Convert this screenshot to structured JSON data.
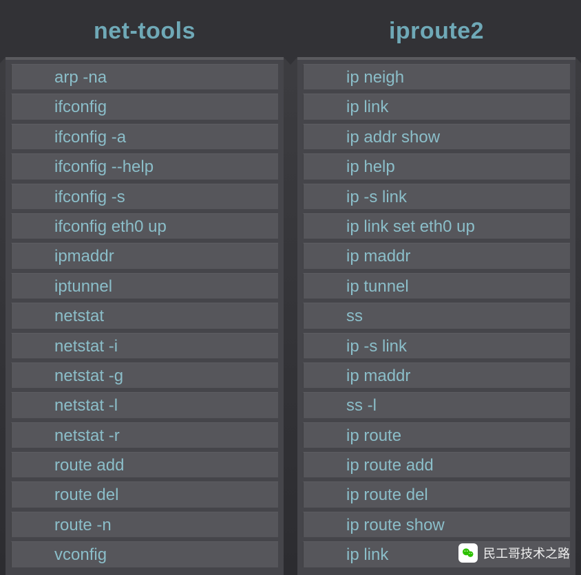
{
  "columns": [
    {
      "title": "net-tools",
      "items": [
        "arp -na",
        "ifconfig",
        "ifconfig -a",
        "ifconfig --help",
        "ifconfig -s",
        "ifconfig eth0 up",
        "ipmaddr",
        "iptunnel",
        "netstat",
        "netstat -i",
        "netstat  -g",
        "netstat -l",
        "netstat -r",
        "route add",
        "route del",
        "route -n",
        "vconfig"
      ]
    },
    {
      "title": "iproute2",
      "items": [
        "ip neigh",
        "ip link",
        "ip addr show",
        "ip help",
        "ip -s link",
        "ip link set eth0 up",
        "ip maddr",
        "ip tunnel",
        "ss",
        "ip -s link",
        "ip maddr",
        "ss -l",
        "ip route",
        "ip route add",
        "ip route del",
        "ip route show",
        "ip link"
      ]
    }
  ],
  "watermark": {
    "text": "民工哥技术之路",
    "icon": "wechat-icon"
  },
  "colors": {
    "background": "#323236",
    "panel": "#45454a",
    "row": "#56565b",
    "text": "#8bbec9",
    "title": "#6fa9b7"
  }
}
